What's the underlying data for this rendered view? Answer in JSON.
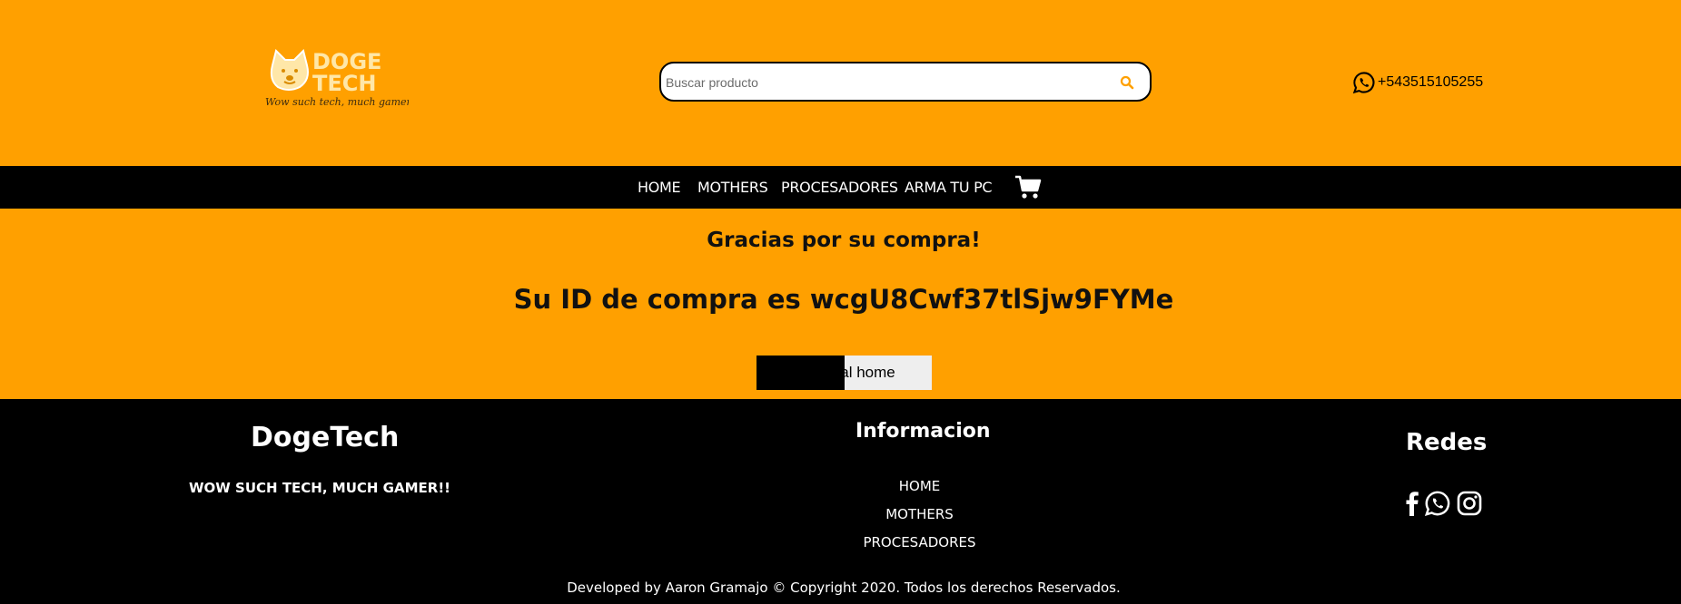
{
  "header": {
    "logo": {
      "line1": "DOGE",
      "line2": "TECH",
      "tagline": "Wow such tech, much gamer!"
    },
    "search": {
      "placeholder": "Buscar producto",
      "value": ""
    },
    "phone": "+543515105255"
  },
  "nav": {
    "items": [
      "HOME",
      "MOTHERS",
      "PROCESADORES",
      "ARMA TU PC"
    ]
  },
  "main": {
    "thanks": "Gracias por su compra!",
    "order_id": "Su ID de compra es wcgU8Cwf37tlSjw9FYMe",
    "back_button": "Volver al home"
  },
  "footer": {
    "brand": "DogeTech",
    "tagline": "WOW SUCH TECH, MUCH GAMER!!",
    "info_title": "Informacion",
    "links": [
      "HOME",
      "MOTHERS",
      "PROCESADORES"
    ],
    "social_title": "Redes",
    "copyright": "Developed by Aaron Gramajo © Copyright 2020. Todos los derechos Reservados."
  },
  "icons": {
    "search": "search-icon",
    "whatsapp": "whatsapp-icon",
    "cart": "cart-icon",
    "facebook": "facebook-icon",
    "instagram": "instagram-icon"
  },
  "colors": {
    "brand_orange": "#ffa000",
    "dark": "#000000",
    "logo_cream": "#ffe7a8"
  }
}
